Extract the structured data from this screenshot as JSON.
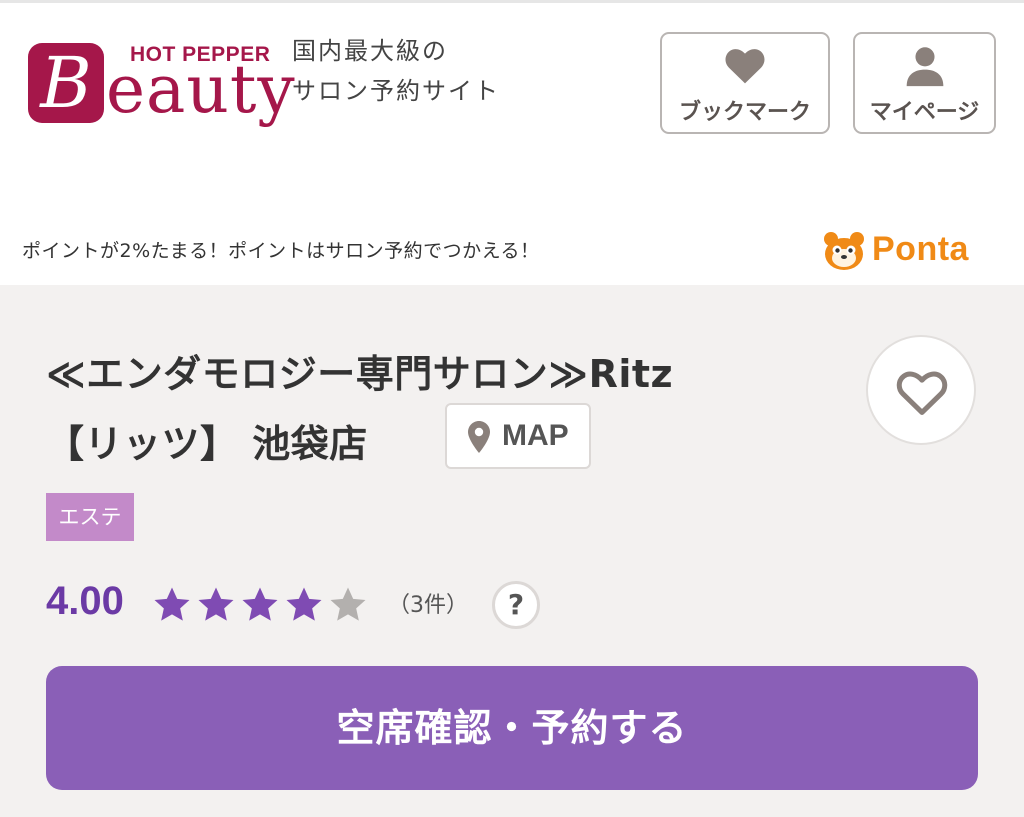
{
  "header": {
    "logo": {
      "mark": "B",
      "top_text": "HOT PEPPER",
      "word": "eauty",
      "color": "#a5174a"
    },
    "tagline": {
      "line1": "国内最大級の",
      "line2": "サロン予約サイト"
    },
    "bookmark_label": "ブックマーク",
    "bookmark_icon": "heart-icon",
    "mypage_label": "マイページ",
    "mypage_icon": "person-icon"
  },
  "ponta_bar": {
    "text": "ポイントが2%たまる！ポイントはサロン予約でつかえる！",
    "brand": "Ponta",
    "brand_color": "#f08a16"
  },
  "salon": {
    "title_line1": "≪エンダモロジー専門サロン≫Ritz",
    "title_line2": "【リッツ】 池袋店",
    "map_label": "MAP",
    "category": "エステ",
    "rating": "4.00",
    "rating_stars": 4,
    "rating_max": 5,
    "review_count": "（3件）",
    "help_label": "?",
    "reserve_label": "空席確認・予約する",
    "accent_color": "#8a5fb7"
  }
}
